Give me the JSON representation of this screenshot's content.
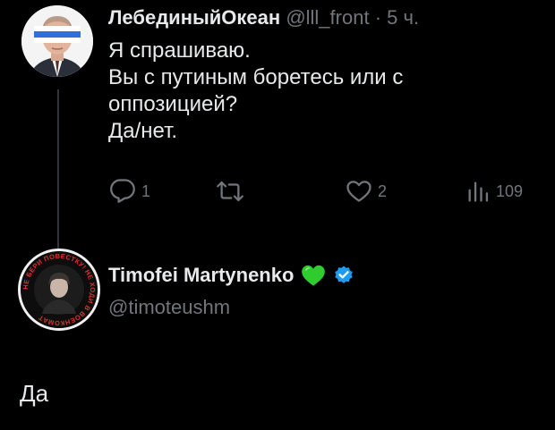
{
  "tweet": {
    "author_name": "ЛебединыйОкеан",
    "handle": "@lll_front",
    "separator": "·",
    "time": "5 ч.",
    "text_lines": [
      "Я спрашиваю.",
      "Вы с путиным боретесь или с",
      "оппозицией?",
      "Да/нет."
    ],
    "stats": {
      "replies": "1",
      "likes": "2",
      "views": "109"
    }
  },
  "reply": {
    "author_name": "Timofei Martynenko",
    "handle": "@timoteushm",
    "text": "Да",
    "avatar_ring_text": "НЕ БЕРИ ПОВЕСТКУ! НЕ ХОДИ В ВОЕНКОМАТ",
    "name_emoji": "green-heart-icon",
    "verified": true
  },
  "colors": {
    "background": "#000000",
    "text": "#e7e9ea",
    "muted": "#71767b",
    "verified_badge": "#1d9bf0",
    "heart": "#2ecc2e",
    "thread_line": "#333639"
  }
}
